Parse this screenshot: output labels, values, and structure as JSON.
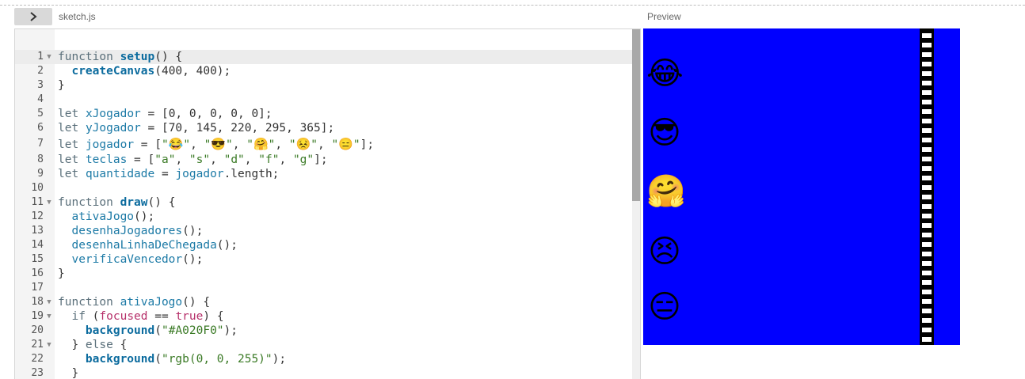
{
  "toolbar": {
    "toggle_icon": "›",
    "file_name": "sketch.js",
    "preview_label": "Preview"
  },
  "lines": [
    {
      "n": "1",
      "fold": true,
      "html": "<span class=\"kw\">function</span> <span class=\"fn\">setup</span>() {"
    },
    {
      "n": "2",
      "fold": false,
      "html": "  <span class=\"fn\">createCanvas</span>(400, 400);"
    },
    {
      "n": "3",
      "fold": false,
      "html": "}"
    },
    {
      "n": "4",
      "fold": false,
      "html": ""
    },
    {
      "n": "5",
      "fold": false,
      "html": "<span class=\"kw\">let</span> <span class=\"var\">xJogador</span> = [0, 0, 0, 0, 0];"
    },
    {
      "n": "6",
      "fold": false,
      "html": "<span class=\"kw\">let</span> <span class=\"var\">yJogador</span> = [70, 145, 220, 295, 365];"
    },
    {
      "n": "7",
      "fold": false,
      "tall": true,
      "html": "<span class=\"kw\">let</span> <span class=\"var\">jogador</span> = [<span class=\"str\">\"<span class=\"emo\">😂</span>\"</span>, <span class=\"str\">\"<span class=\"emo\">😎</span>\"</span>, <span class=\"str\">\"<span class=\"emo\">🤗</span>\"</span>, <span class=\"str\">\"<span class=\"emo\">😣</span>\"</span>, <span class=\"str\">\"<span class=\"emo\">😑</span>\"</span>];"
    },
    {
      "n": "8",
      "fold": false,
      "html": "<span class=\"kw\">let</span> <span class=\"var\">teclas</span> = [<span class=\"str\">\"a\"</span>, <span class=\"str\">\"s\"</span>, <span class=\"str\">\"d\"</span>, <span class=\"str\">\"f\"</span>, <span class=\"str\">\"g\"</span>];"
    },
    {
      "n": "9",
      "fold": false,
      "html": "<span class=\"kw\">let</span> <span class=\"var\">quantidade</span> = <span class=\"var\">jogador</span>.length;"
    },
    {
      "n": "10",
      "fold": false,
      "html": ""
    },
    {
      "n": "11",
      "fold": true,
      "html": "<span class=\"kw\">function</span> <span class=\"fn\">draw</span>() {"
    },
    {
      "n": "12",
      "fold": false,
      "html": "  <span class=\"var\">ativaJogo</span>();"
    },
    {
      "n": "13",
      "fold": false,
      "html": "  <span class=\"var\">desenhaJogadores</span>();"
    },
    {
      "n": "14",
      "fold": false,
      "html": "  <span class=\"var\">desenhaLinhaDeChegada</span>();"
    },
    {
      "n": "15",
      "fold": false,
      "html": "  <span class=\"var\">verificaVencedor</span>();"
    },
    {
      "n": "16",
      "fold": false,
      "html": "}"
    },
    {
      "n": "17",
      "fold": false,
      "html": ""
    },
    {
      "n": "18",
      "fold": true,
      "html": "<span class=\"kw\">function</span> <span class=\"var\">ativaJogo</span>() {"
    },
    {
      "n": "19",
      "fold": true,
      "html": "  <span class=\"kw\">if</span> (<span class=\"prop\">focused</span> == <span class=\"bool\">true</span>) {"
    },
    {
      "n": "20",
      "fold": false,
      "html": "    <span class=\"fn\">background</span>(<span class=\"str\">\"#A020F0\"</span>);"
    },
    {
      "n": "21",
      "fold": true,
      "html": "  } <span class=\"kw\">else</span> {"
    },
    {
      "n": "22",
      "fold": false,
      "html": "    <span class=\"fn\">background</span>(<span class=\"str\">\"rgb(0, 0, 255)\"</span>);"
    },
    {
      "n": "23",
      "fold": false,
      "html": "  }"
    }
  ],
  "preview": {
    "canvas_color": "#0000ff",
    "players": [
      "😂",
      "😎",
      "🤗",
      "😣",
      "😑"
    ]
  }
}
